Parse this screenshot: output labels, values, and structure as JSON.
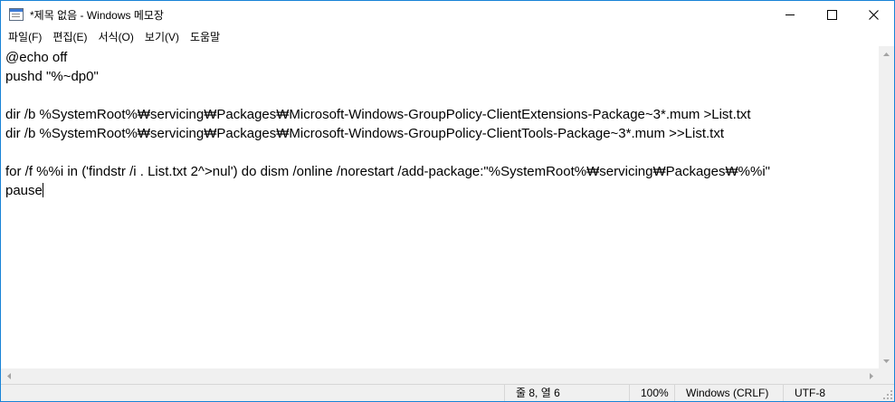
{
  "window": {
    "title": "*제목 없음 - Windows 메모장"
  },
  "menu": [
    "파일(F)",
    "편집(E)",
    "서식(O)",
    "보기(V)",
    "도움말"
  ],
  "editor": {
    "lines": [
      "@echo off",
      "pushd \"%~dp0\"",
      "",
      "dir /b %SystemRoot%₩servicing₩Packages₩Microsoft-Windows-GroupPolicy-ClientExtensions-Package~3*.mum >List.txt",
      "dir /b %SystemRoot%₩servicing₩Packages₩Microsoft-Windows-GroupPolicy-ClientTools-Package~3*.mum >>List.txt",
      "",
      "for /f %%i in ('findstr /i . List.txt 2^>nul') do dism /online /norestart /add-package:\"%SystemRoot%₩servicing₩Packages₩%%i\"",
      "pause"
    ]
  },
  "status": {
    "position": "줄 8, 열 6",
    "zoom": "100%",
    "line_ending": "Windows (CRLF)",
    "encoding": "UTF-8"
  },
  "icons": {
    "app": "notepad-icon",
    "minimize": "minimize-icon",
    "maximize": "maximize-icon",
    "close": "close-icon"
  }
}
